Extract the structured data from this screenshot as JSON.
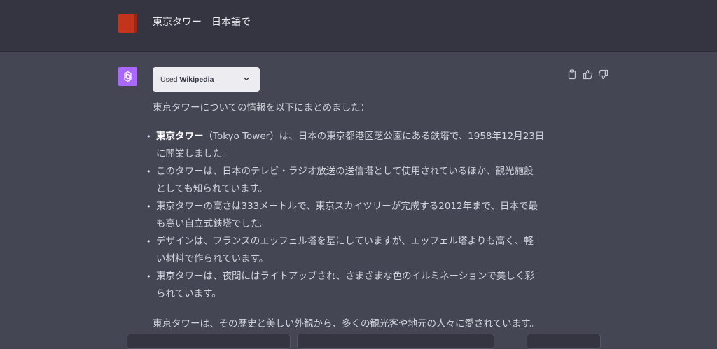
{
  "user_message": {
    "text": "東京タワー　日本語で"
  },
  "assistant_message": {
    "plugin_chip": {
      "used_label": "Used",
      "plugin_name": "Wikipedia"
    },
    "intro": "東京タワーについての情報を以下にまとめました：",
    "bullets": [
      {
        "bold": "東京タワー",
        "line1": "（Tokyo Tower）は、日本の東京都港区芝公園にある鉄塔で、1958年12月23日",
        "line2": "に開業しました。"
      },
      {
        "bold": "",
        "line1": "このタワーは、日本のテレビ・ラジオ放送の送信塔として使用されているほか、観光施設",
        "line2": "としても知られています。"
      },
      {
        "bold": "",
        "line1": "東京タワーの高さは333メートルで、東京スカイツリーが完成する2012年まで、日本で最",
        "line2": "も高い自立式鉄塔でした。"
      },
      {
        "bold": "",
        "line1": "デザインは、フランスのエッフェル塔を基にしていますが、エッフェル塔よりも高く、軽",
        "line2": "い材料で作られています。"
      },
      {
        "bold": "",
        "line1": "東京タワーは、夜間にはライトアップされ、さまざまな色のイルミネーションで美しく彩",
        "line2": "られています。"
      }
    ],
    "outro": "東京タワーは、その歴史と美しい外観から、多くの観光客や地元の人々に愛されています。"
  },
  "icons": {
    "copy": "clipboard-icon",
    "thumbs_up": "thumbs-up-icon",
    "thumbs_down": "thumbs-down-icon",
    "chevron": "chevron-down-icon",
    "assistant_logo": "openai-logo-icon"
  },
  "colors": {
    "page_bg": "#444654",
    "user_row_bg": "#343541",
    "user_avatar": "#c3341c",
    "assistant_avatar": "#ab68ff",
    "chip_bg": "#ececf1"
  }
}
